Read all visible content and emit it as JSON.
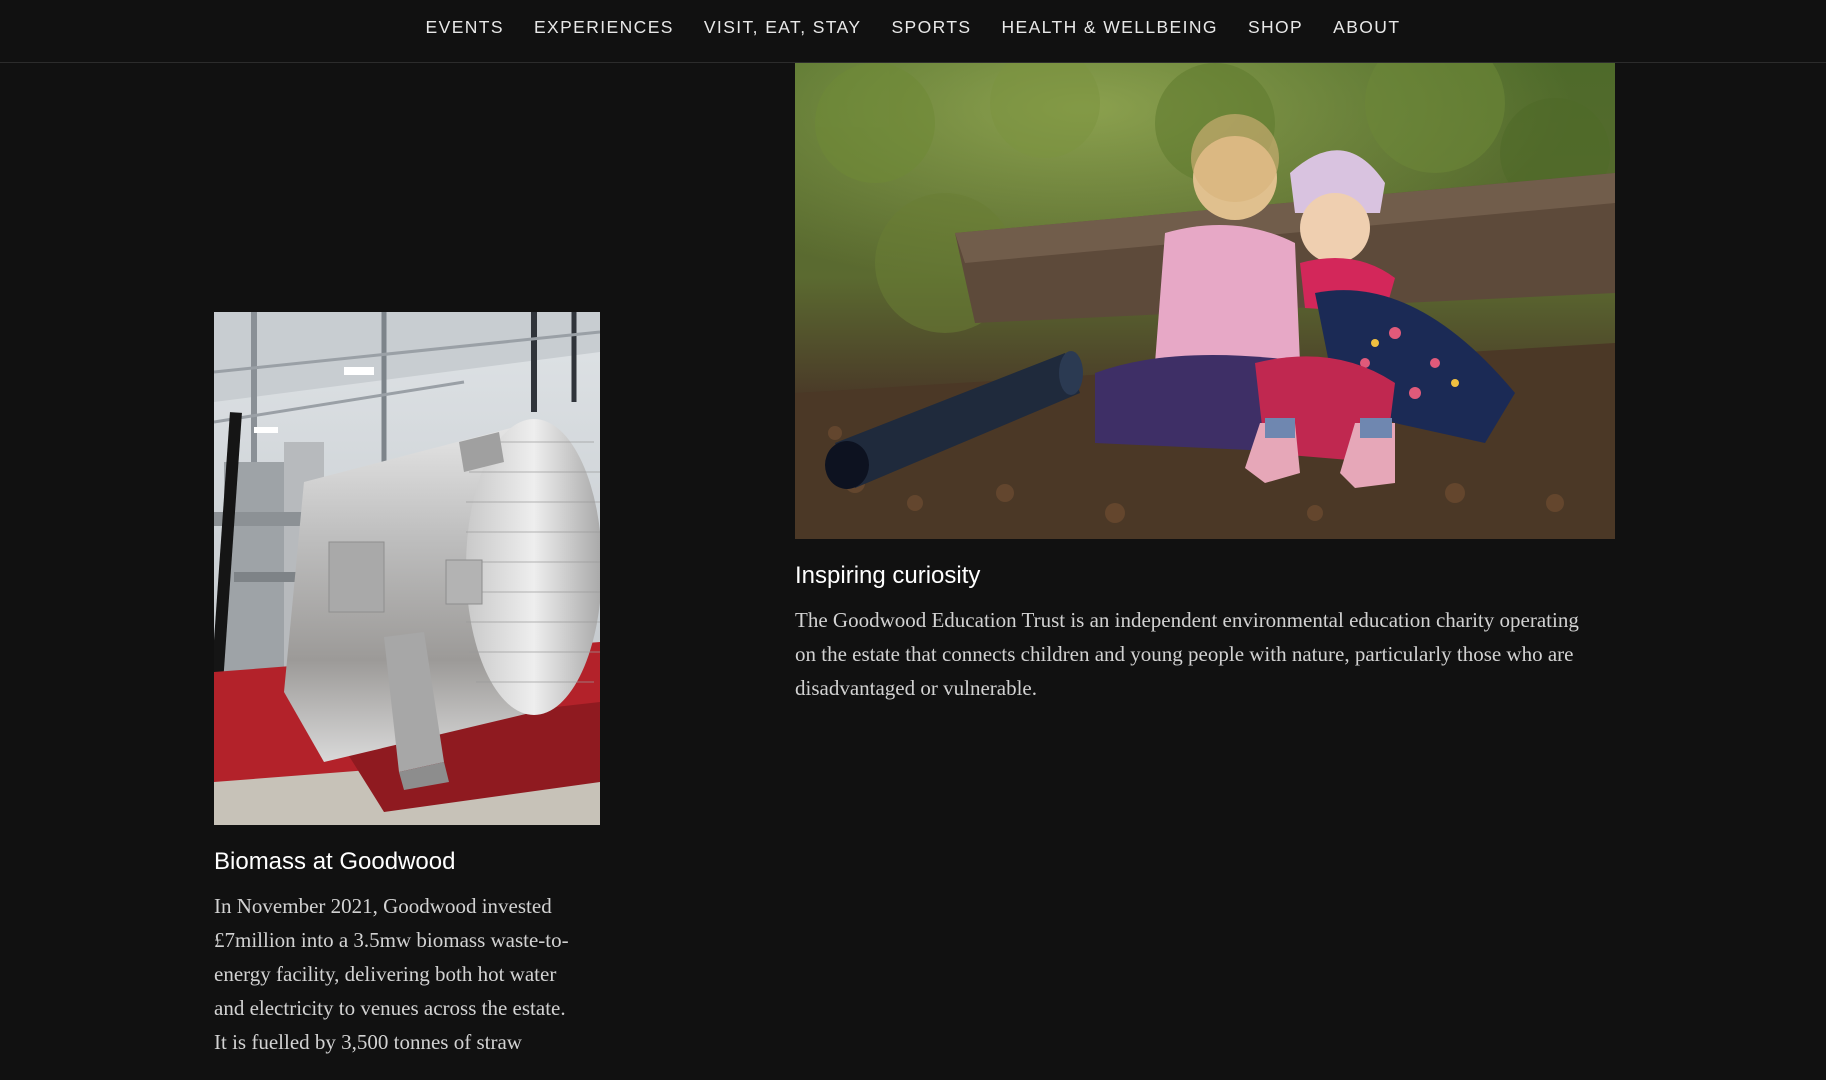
{
  "nav": {
    "items": [
      {
        "label": "EVENTS"
      },
      {
        "label": "EXPERIENCES"
      },
      {
        "label": "VISIT, EAT, STAY"
      },
      {
        "label": "SPORTS"
      },
      {
        "label": "HEALTH & WELLBEING"
      },
      {
        "label": "SHOP"
      },
      {
        "label": "ABOUT"
      }
    ]
  },
  "cards": {
    "biomass": {
      "title": "Biomass at Goodwood",
      "body": "In November 2021, Goodwood invested £7million into a 3.5mw biomass waste-to-energy facility, delivering both hot water and electricity to venues across the estate. It is fuelled by 3,500 tonnes of straw"
    },
    "education": {
      "title": "Inspiring curiosity",
      "body": "The Goodwood Education Trust is an independent environmental education charity operating on the estate that connects children and young people with nature, particularly those who are disadvantaged or vulnerable."
    }
  },
  "colors": {
    "background": "#111111",
    "nav_text": "#e8e8e8",
    "title_text": "#ffffff",
    "body_text": "#d2d2d2"
  }
}
